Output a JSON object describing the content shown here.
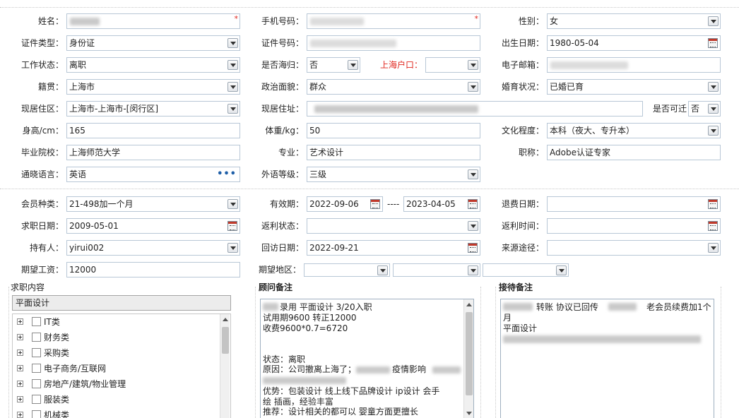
{
  "personal": {
    "name_label": "姓名：",
    "phone_label": "手机号码：",
    "gender_label": "性别：",
    "gender_value": "女",
    "id_type_label": "证件类型：",
    "id_type_value": "身份证",
    "id_no_label": "证件号码：",
    "birth_label": "出生日期：",
    "birth_value": "1980-05-04",
    "work_status_label": "工作状态：",
    "work_status_value": "离职",
    "returnee_label": "是否海归：",
    "returnee_value": "否",
    "hukou_label": "上海户口：",
    "hukou_value": "",
    "email_label": "电子邮箱：",
    "native_label": "籍贯：",
    "native_value": "上海市",
    "political_label": "政治面貌：",
    "political_value": "群众",
    "marital_label": "婚育状况：",
    "marital_value": "已婚已育",
    "district_label": "现居住区：",
    "district_value": "上海市-上海市-[闵行区]",
    "address_label": "现居住址：",
    "relocate_label": "是否可迁",
    "relocate_value": "否",
    "height_label": "身高/cm：",
    "height_value": "165",
    "weight_label": "体重/kg：",
    "weight_value": "50",
    "education_label": "文化程度：",
    "education_value": "本科（夜大、专升本）",
    "school_label": "毕业院校：",
    "school_value": "上海师范大学",
    "major_label": "专业：",
    "major_value": "艺术设计",
    "title_label": "职称：",
    "title_value": "Adobe认证专家",
    "language_label": "通晓语言：",
    "language_value": "英语",
    "language_more": "•••",
    "foreign_level_label": "外语等级：",
    "foreign_level_value": "三级"
  },
  "membership": {
    "member_type_label": "会员种类：",
    "member_type_value": "21-498加一个月",
    "valid_label": "有效期：",
    "valid_from": "2022-09-06",
    "valid_sep": "----",
    "valid_to": "2023-04-05",
    "refund_date_label": "退费日期：",
    "refund_date_value": "",
    "job_date_label": "求职日期：",
    "job_date_value": "2009-05-01",
    "rebate_status_label": "返利状态：",
    "rebate_status_value": "",
    "rebate_time_label": "返利时间：",
    "rebate_time_value": "",
    "holder_label": "持有人：",
    "holder_value": "yirui002",
    "visit_date_label": "回访日期：",
    "visit_date_value": "2022-09-21",
    "source_label": "来源途径：",
    "source_value": "",
    "salary_label": "期望工资：",
    "salary_value": "12000",
    "region_label": "期望地区："
  },
  "job_content": {
    "title": "求职内容",
    "selected": "平面设计",
    "tree_items": [
      {
        "label": "IT类"
      },
      {
        "label": "财务类"
      },
      {
        "label": "采购类"
      },
      {
        "label": "电子商务/互联网"
      },
      {
        "label": "房地产/建筑/物业管理"
      },
      {
        "label": "服装类"
      },
      {
        "label": "机械类"
      }
    ]
  },
  "advisor_notes": {
    "title": "顾问备注",
    "line1": "录用 平面设计 3/20入职",
    "line2": "试用期9600 转正12000",
    "line3": "收费9600*0.7=6720",
    "line4": "状态：离职",
    "line5": "原因：公司撤离上海了；",
    "line5b": "疫情影响",
    "line6": "优势：包装设计 线上线下品牌设计  ip设计  会手",
    "line7": "绘  插画，经验丰富",
    "line8": "推荐：设计相关的都可以  婴童方面更擅长"
  },
  "reception_notes": {
    "title": "接待备注",
    "line1a": "转账 协议已回传",
    "line1b": "老会员续费加1个",
    "line2": "月",
    "line3": "平面设计"
  },
  "colors": {
    "border": "#b8c7d6",
    "required": "#e0261e",
    "hukou_label": "#e0261e",
    "link": "#1f5fa8"
  }
}
